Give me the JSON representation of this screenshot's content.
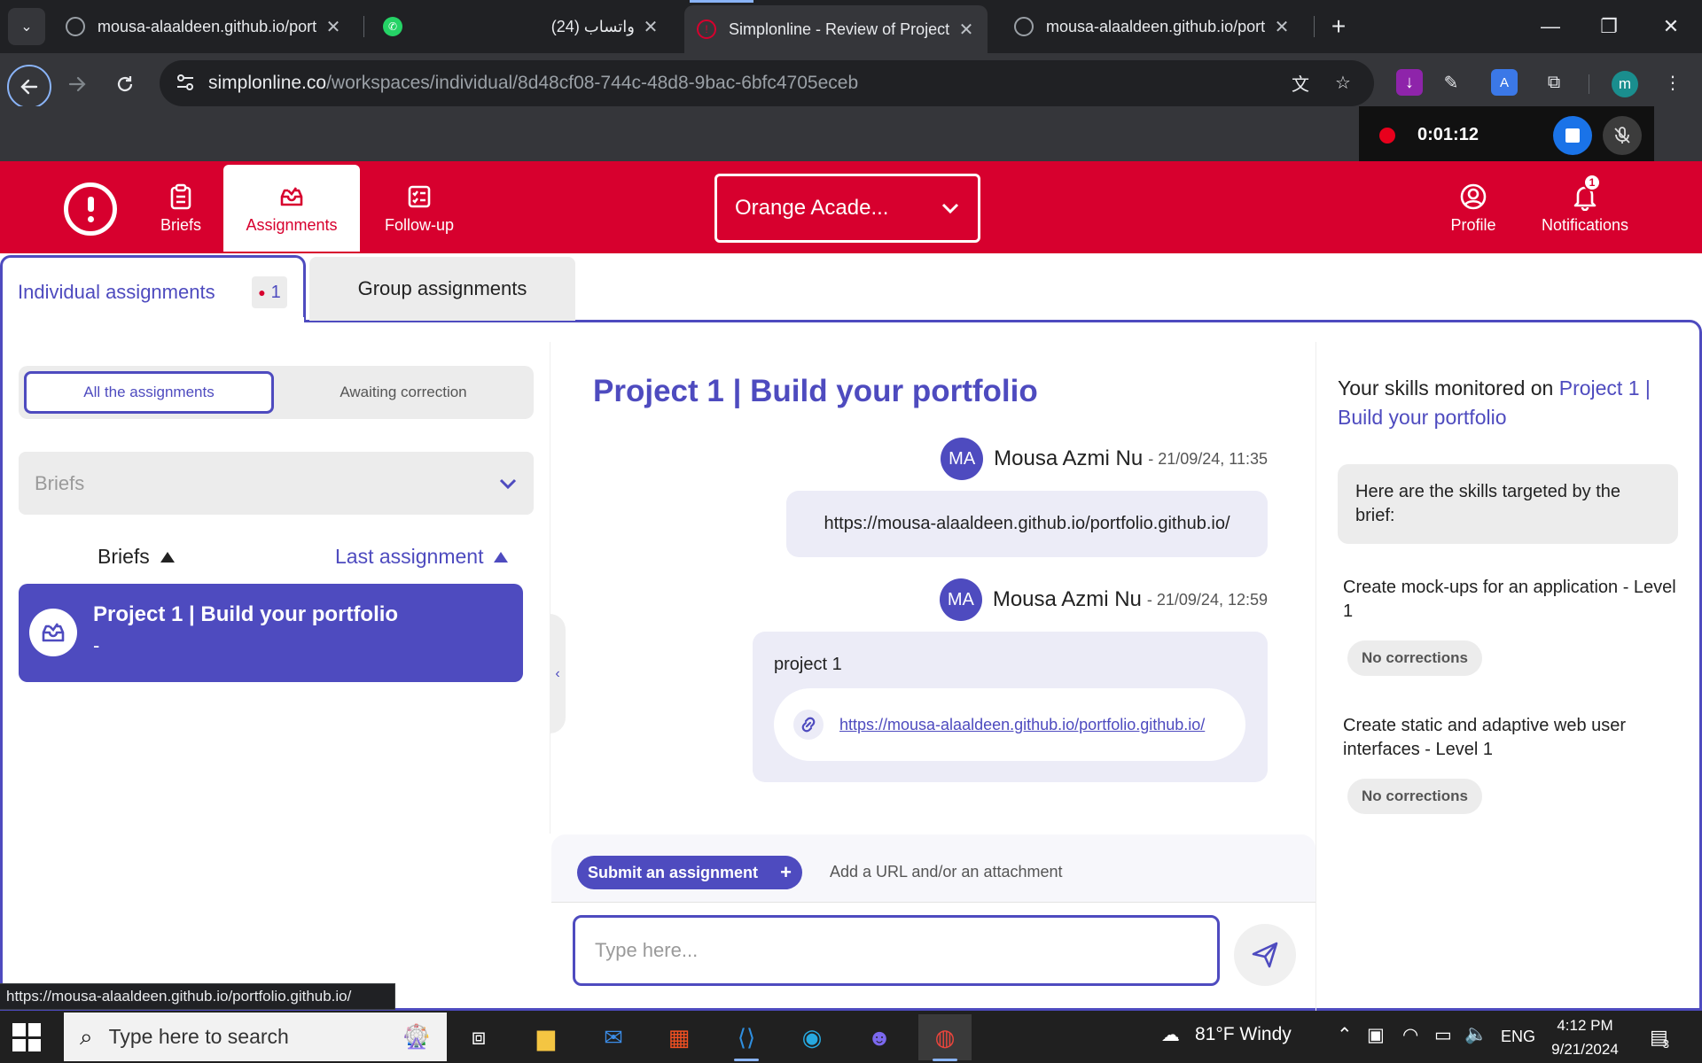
{
  "browser": {
    "tabs": [
      {
        "title": "mousa-alaaldeen.github.io/port",
        "active": false
      },
      {
        "title": "واتساب (24)",
        "active": false
      },
      {
        "title": "Simplonline - Review of Project",
        "active": true
      },
      {
        "title": "mousa-alaaldeen.github.io/port",
        "active": false
      }
    ],
    "url_host": "simplonline.co",
    "url_path": "/workspaces/individual/8d48cf08-744c-48d8-9bac-6bfc4705eceb",
    "profile_initial": "m",
    "recording_time": "0:01:12",
    "status_url": "https://mousa-alaaldeen.github.io/portfolio.github.io/"
  },
  "header": {
    "nav": {
      "briefs": "Briefs",
      "assignments": "Assignments",
      "followup": "Follow-up",
      "profile": "Profile",
      "notifications": "Notifications"
    },
    "org_select": "Orange Acade...",
    "notifications_count": "1"
  },
  "assignment_tabs": {
    "individual": "Individual assignments",
    "individual_count": "1",
    "group": "Group assignments"
  },
  "left": {
    "toggle_all": "All the assignments",
    "toggle_awaiting": "Awaiting correction",
    "briefs_placeholder": "Briefs",
    "sort_briefs": "Briefs",
    "sort_last": "Last assignment",
    "brief_card": {
      "title": "Project 1 | Build your portfolio",
      "sub": "-"
    }
  },
  "middle": {
    "title": "Project 1 | Build your portfolio",
    "messages": [
      {
        "initials": "MA",
        "name": "Mousa Azmi Nu",
        "date": "- 21/09/24, 11:35",
        "body": "https://mousa-alaaldeen.github.io/portfolio.github.io/"
      },
      {
        "initials": "MA",
        "name": "Mousa Azmi Nu",
        "date": "- 21/09/24, 12:59",
        "body": "project 1",
        "link": "https://mousa-alaaldeen.github.io/portfolio.github.io/"
      }
    ],
    "submit_button": "Submit an assignment",
    "submit_hint": "Add a URL and/or an attachment",
    "input_placeholder": "Type here..."
  },
  "right": {
    "title_prefix": "Your skills monitored on",
    "title_project": "Project 1 | Build your portfolio",
    "intro": "Here are the skills targeted by the brief:",
    "skills": [
      {
        "name": "Create mock-ups for an application - Level 1",
        "status": "No corrections"
      },
      {
        "name": "Create static and adaptive web user interfaces - Level 1",
        "status": "No corrections"
      }
    ]
  },
  "taskbar": {
    "search_placeholder": "Type here to search",
    "weather": "81°F  Windy",
    "language": "ENG",
    "time": "4:12 PM",
    "date": "9/21/2024",
    "notification_count": "3"
  },
  "colors": {
    "brand_red": "#d7002e",
    "accent_purple": "#4e4bbf"
  }
}
